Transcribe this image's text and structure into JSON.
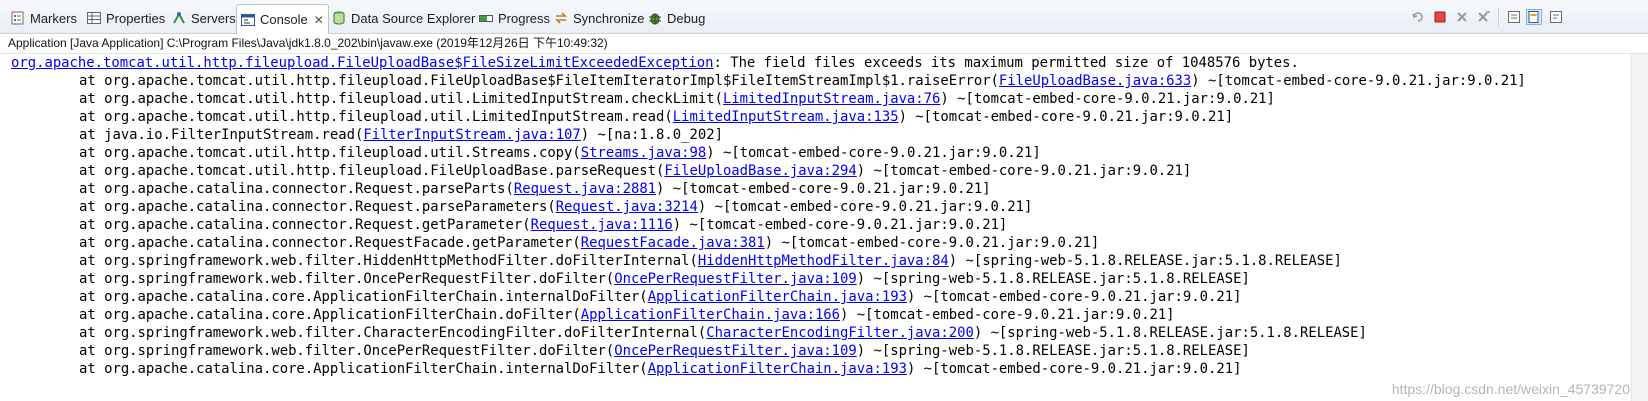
{
  "tabs": [
    {
      "label": "Markers",
      "icon": "markers-icon"
    },
    {
      "label": "Properties",
      "icon": "properties-icon"
    },
    {
      "label": "Servers",
      "icon": "servers-icon"
    },
    {
      "label": "Console",
      "icon": "console-icon",
      "active": true
    },
    {
      "label": "Data Source Explorer",
      "icon": "data-source-icon"
    },
    {
      "label": "Progress",
      "icon": "progress-icon"
    },
    {
      "label": "Synchronize",
      "icon": "synchronize-icon"
    },
    {
      "label": "Debug",
      "icon": "debug-icon"
    }
  ],
  "console_close": "✕",
  "toolbar_icons": [
    "remove-launch-icon",
    "terminate-icon",
    "remove-all-terminated-icon",
    "clear-console-icon",
    "scroll-lock-icon",
    "pin-console-icon",
    "word-wrap-icon"
  ],
  "description": "Application [Java Application] C:\\Program Files\\Java\\jdk1.8.0_202\\bin\\javaw.exe (2019年12月26日 下午10:49:32)",
  "exception": {
    "class": "org.apache.tomcat.util.http.fileupload.FileUploadBase$FileSizeLimitExceededException",
    "message": ": The field files exceeds its maximum permitted size of 1048576 bytes."
  },
  "stack": [
    {
      "pre": "at org.apache.tomcat.util.http.fileupload.FileUploadBase$FileItemIteratorImpl$FileItemStreamImpl$1.raiseError(",
      "link": "FileUploadBase.java:633",
      "post": ") ~[tomcat-embed-core-9.0.21.jar:9.0.21]"
    },
    {
      "pre": "at org.apache.tomcat.util.http.fileupload.util.LimitedInputStream.checkLimit(",
      "link": "LimitedInputStream.java:76",
      "post": ") ~[tomcat-embed-core-9.0.21.jar:9.0.21]"
    },
    {
      "pre": "at org.apache.tomcat.util.http.fileupload.util.LimitedInputStream.read(",
      "link": "LimitedInputStream.java:135",
      "post": ") ~[tomcat-embed-core-9.0.21.jar:9.0.21]"
    },
    {
      "pre": "at java.io.FilterInputStream.read(",
      "link": "FilterInputStream.java:107",
      "post": ") ~[na:1.8.0_202]"
    },
    {
      "pre": "at org.apache.tomcat.util.http.fileupload.util.Streams.copy(",
      "link": "Streams.java:98",
      "post": ") ~[tomcat-embed-core-9.0.21.jar:9.0.21]"
    },
    {
      "pre": "at org.apache.tomcat.util.http.fileupload.FileUploadBase.parseRequest(",
      "link": "FileUploadBase.java:294",
      "post": ") ~[tomcat-embed-core-9.0.21.jar:9.0.21]"
    },
    {
      "pre": "at org.apache.catalina.connector.Request.parseParts(",
      "link": "Request.java:2881",
      "post": ") ~[tomcat-embed-core-9.0.21.jar:9.0.21]"
    },
    {
      "pre": "at org.apache.catalina.connector.Request.parseParameters(",
      "link": "Request.java:3214",
      "post": ") ~[tomcat-embed-core-9.0.21.jar:9.0.21]"
    },
    {
      "pre": "at org.apache.catalina.connector.Request.getParameter(",
      "link": "Request.java:1116",
      "post": ") ~[tomcat-embed-core-9.0.21.jar:9.0.21]"
    },
    {
      "pre": "at org.apache.catalina.connector.RequestFacade.getParameter(",
      "link": "RequestFacade.java:381",
      "post": ") ~[tomcat-embed-core-9.0.21.jar:9.0.21]"
    },
    {
      "pre": "at org.springframework.web.filter.HiddenHttpMethodFilter.doFilterInternal(",
      "link": "HiddenHttpMethodFilter.java:84",
      "post": ") ~[spring-web-5.1.8.RELEASE.jar:5.1.8.RELEASE]"
    },
    {
      "pre": "at org.springframework.web.filter.OncePerRequestFilter.doFilter(",
      "link": "OncePerRequestFilter.java:109",
      "post": ") ~[spring-web-5.1.8.RELEASE.jar:5.1.8.RELEASE]"
    },
    {
      "pre": "at org.apache.catalina.core.ApplicationFilterChain.internalDoFilter(",
      "link": "ApplicationFilterChain.java:193",
      "post": ") ~[tomcat-embed-core-9.0.21.jar:9.0.21]"
    },
    {
      "pre": "at org.apache.catalina.core.ApplicationFilterChain.doFilter(",
      "link": "ApplicationFilterChain.java:166",
      "post": ") ~[tomcat-embed-core-9.0.21.jar:9.0.21]"
    },
    {
      "pre": "at org.springframework.web.filter.CharacterEncodingFilter.doFilterInternal(",
      "link": "CharacterEncodingFilter.java:200",
      "post": ") ~[spring-web-5.1.8.RELEASE.jar:5.1.8.RELEASE]"
    },
    {
      "pre": "at org.springframework.web.filter.OncePerRequestFilter.doFilter(",
      "link": "OncePerRequestFilter.java:109",
      "post": ") ~[spring-web-5.1.8.RELEASE.jar:5.1.8.RELEASE]"
    },
    {
      "pre": "at org.apache.catalina.core.ApplicationFilterChain.internalDoFilter(",
      "link": "ApplicationFilterChain.java:193",
      "post": ") ~[tomcat-embed-core-9.0.21.jar:9.0.21]"
    }
  ],
  "watermark": "https://blog.csdn.net/weixin_45739720",
  "colors": {
    "error_text": "#e00000",
    "link": "#0000ff",
    "tab_bg": "#e9eef5"
  }
}
